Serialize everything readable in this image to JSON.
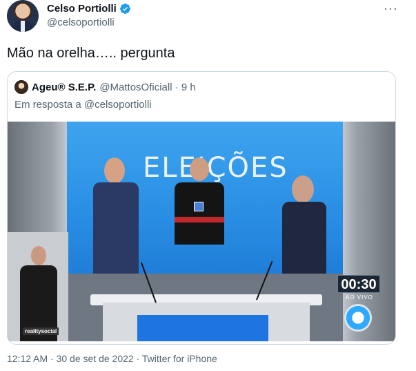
{
  "author": {
    "name": "Celso Portiolli",
    "handle": "@celsoportiolli"
  },
  "tweet": {
    "text": "Mão na orelha….. pergunta",
    "meta": "12:12 AM · 30 de set de 2022 · Twitter for iPhone"
  },
  "quoted": {
    "name": "Ageu® S.E.P.",
    "handle": "@MattosOficiall · 9 h",
    "reply_to": "Em resposta a @celsoportiolli",
    "video": {
      "backdrop_text": "ELEIÇÕES",
      "timer": "00:30",
      "live_label": "AO VIVO",
      "watermark": "realitysocial"
    }
  },
  "colors": {
    "text": "#0f1419",
    "secondary": "#536471",
    "border": "#cfd9de",
    "verified": "#1d9bf0"
  }
}
